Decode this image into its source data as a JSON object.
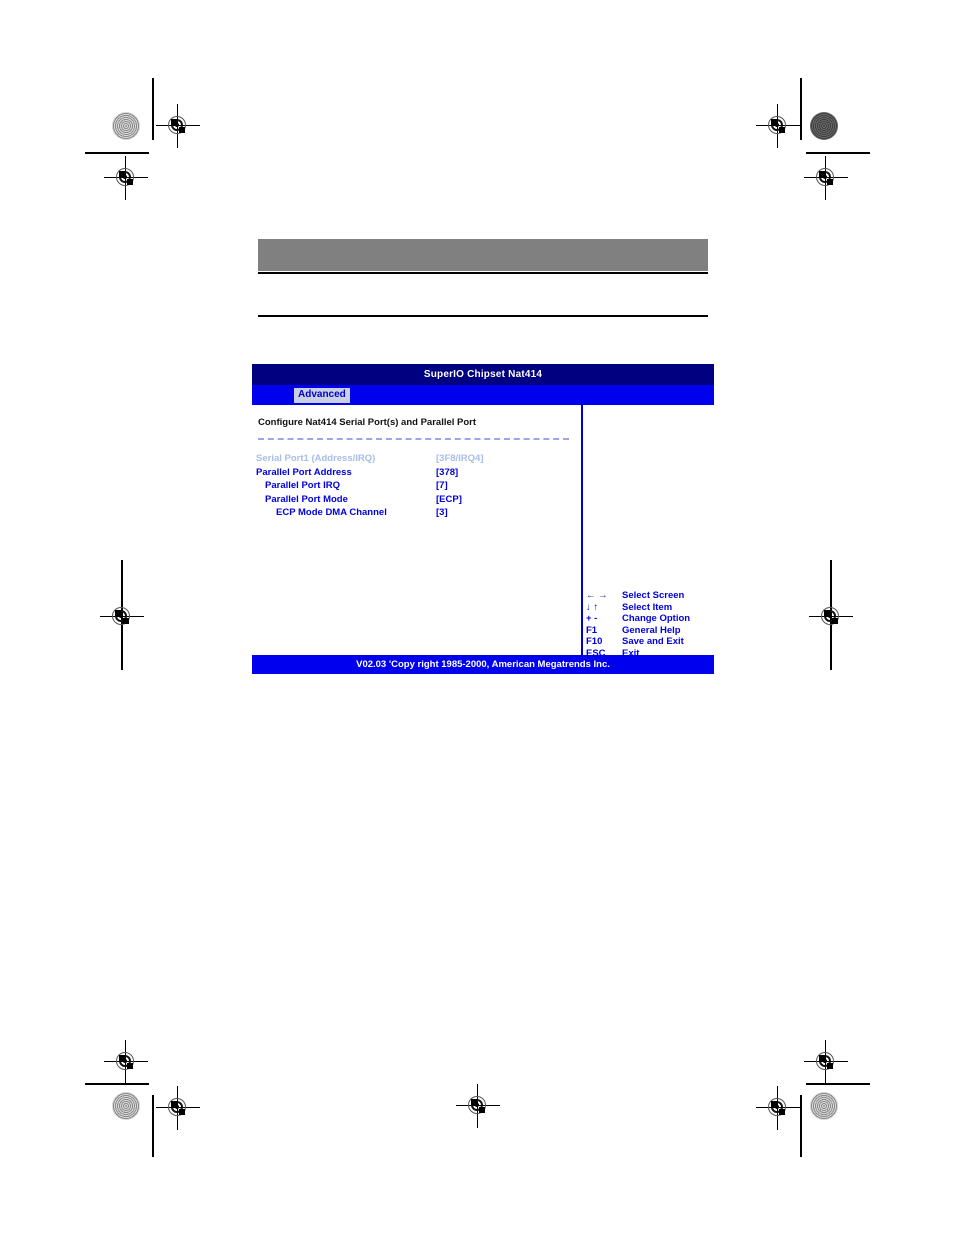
{
  "bios": {
    "title": "SuperIO Chipset Nat414",
    "menu_tab": "Advanced",
    "section_heading": "Configure Nat414 Serial Port(s) and Parallel Port",
    "options": [
      {
        "label": "Serial Port1 (Address/IRQ)",
        "value": "[3F8/IRQ4]",
        "state": "disabled",
        "indent": 0
      },
      {
        "label": "Parallel Port Address",
        "value": "[378]",
        "state": "normal",
        "indent": 0
      },
      {
        "label": "Parallel Port IRQ",
        "value": "[7]",
        "state": "normal",
        "indent": 1
      },
      {
        "label": "Parallel Port Mode",
        "value": "[ECP]",
        "state": "normal",
        "indent": 1
      },
      {
        "label": "ECP Mode DMA Channel",
        "value": "[3]",
        "state": "normal",
        "indent": 2
      }
    ],
    "keys": [
      {
        "combo": "←  →",
        "desc": "Select Screen"
      },
      {
        "combo": "↓   ↑",
        "desc": "Select Item"
      },
      {
        "combo": "+  -",
        "desc": "Change Option"
      },
      {
        "combo": "F1",
        "desc": "General Help"
      },
      {
        "combo": "F10",
        "desc": "Save and Exit"
      },
      {
        "combo": "ESC",
        "desc": "Exit"
      }
    ],
    "footer": "V02.03 'Copy  right 1985-2000, American Megatrends Inc.",
    "colors": {
      "titlebar": "#000080",
      "menubar": "#0000EE",
      "tab_bg": "#C9CFE4",
      "text_blue": "#0000DD",
      "text_disabled": "#A9BDE8",
      "dashed_rule": "#9AA8E6",
      "footer_bg": "#0000EE"
    }
  },
  "page": {
    "gray_band_color": "#808080",
    "rule_color": "#000000"
  }
}
